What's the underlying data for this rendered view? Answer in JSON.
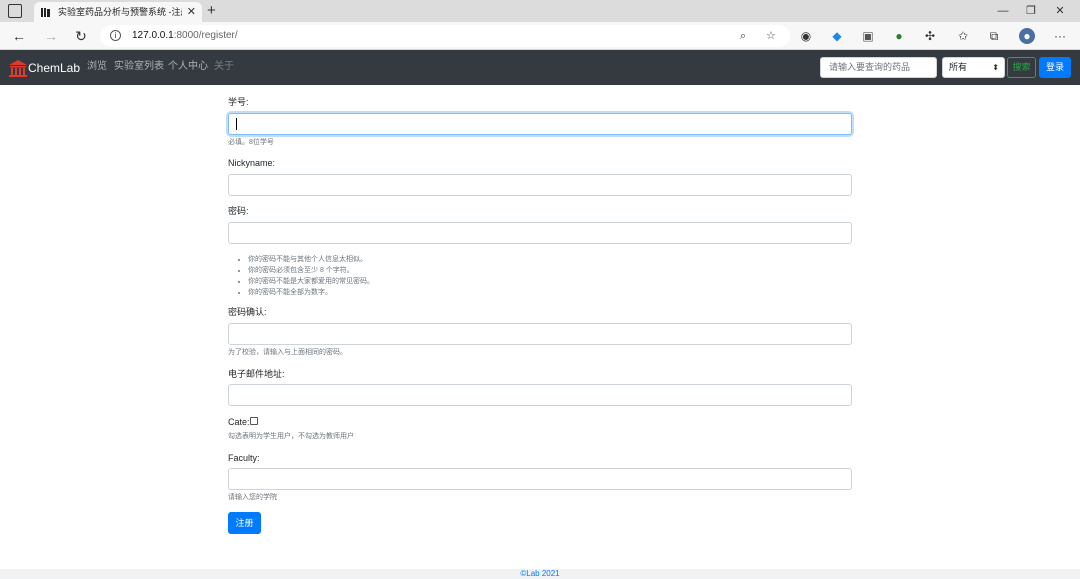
{
  "browser": {
    "tab_title": "实验室药品分析与预警系统 -注册",
    "url_host": "127.0.0.1",
    "url_path": ":8000/register/"
  },
  "navbar": {
    "brand": "ChemLab",
    "links": [
      "浏览",
      "实验室列表",
      "个人中心",
      "关于"
    ],
    "search_placeholder": "请输入要查询的药品",
    "select_value": "所有",
    "search_button": "搜索",
    "login_button": "登录"
  },
  "form": {
    "student_id": {
      "label": "学号:",
      "value": "",
      "help": "必填。8位学号"
    },
    "nickname": {
      "label": "Nickyname:",
      "value": ""
    },
    "password": {
      "label": "密码:",
      "value": "",
      "help_items": [
        "你的密码不能与其他个人信息太相似。",
        "你的密码必须包含至少 8 个字符。",
        "你的密码不能是大家都爱用的常见密码。",
        "你的密码不能全部为数字。"
      ]
    },
    "password_confirm": {
      "label": "密码确认:",
      "value": "",
      "help": "为了校验，请输入与上面相同的密码。"
    },
    "email": {
      "label": "电子邮件地址:",
      "value": ""
    },
    "cate": {
      "label": "Cate:",
      "checked": false,
      "help": "勾选表明为学生用户，不勾选为教师用户"
    },
    "faculty": {
      "label": "Faculty:",
      "value": "",
      "help": "请输入您的学院"
    },
    "submit_label": "注册"
  },
  "footer": {
    "text": "©Lab 2021"
  },
  "colors": {
    "navbar": "#343a40",
    "primary": "#007bff",
    "success": "#28a745"
  }
}
